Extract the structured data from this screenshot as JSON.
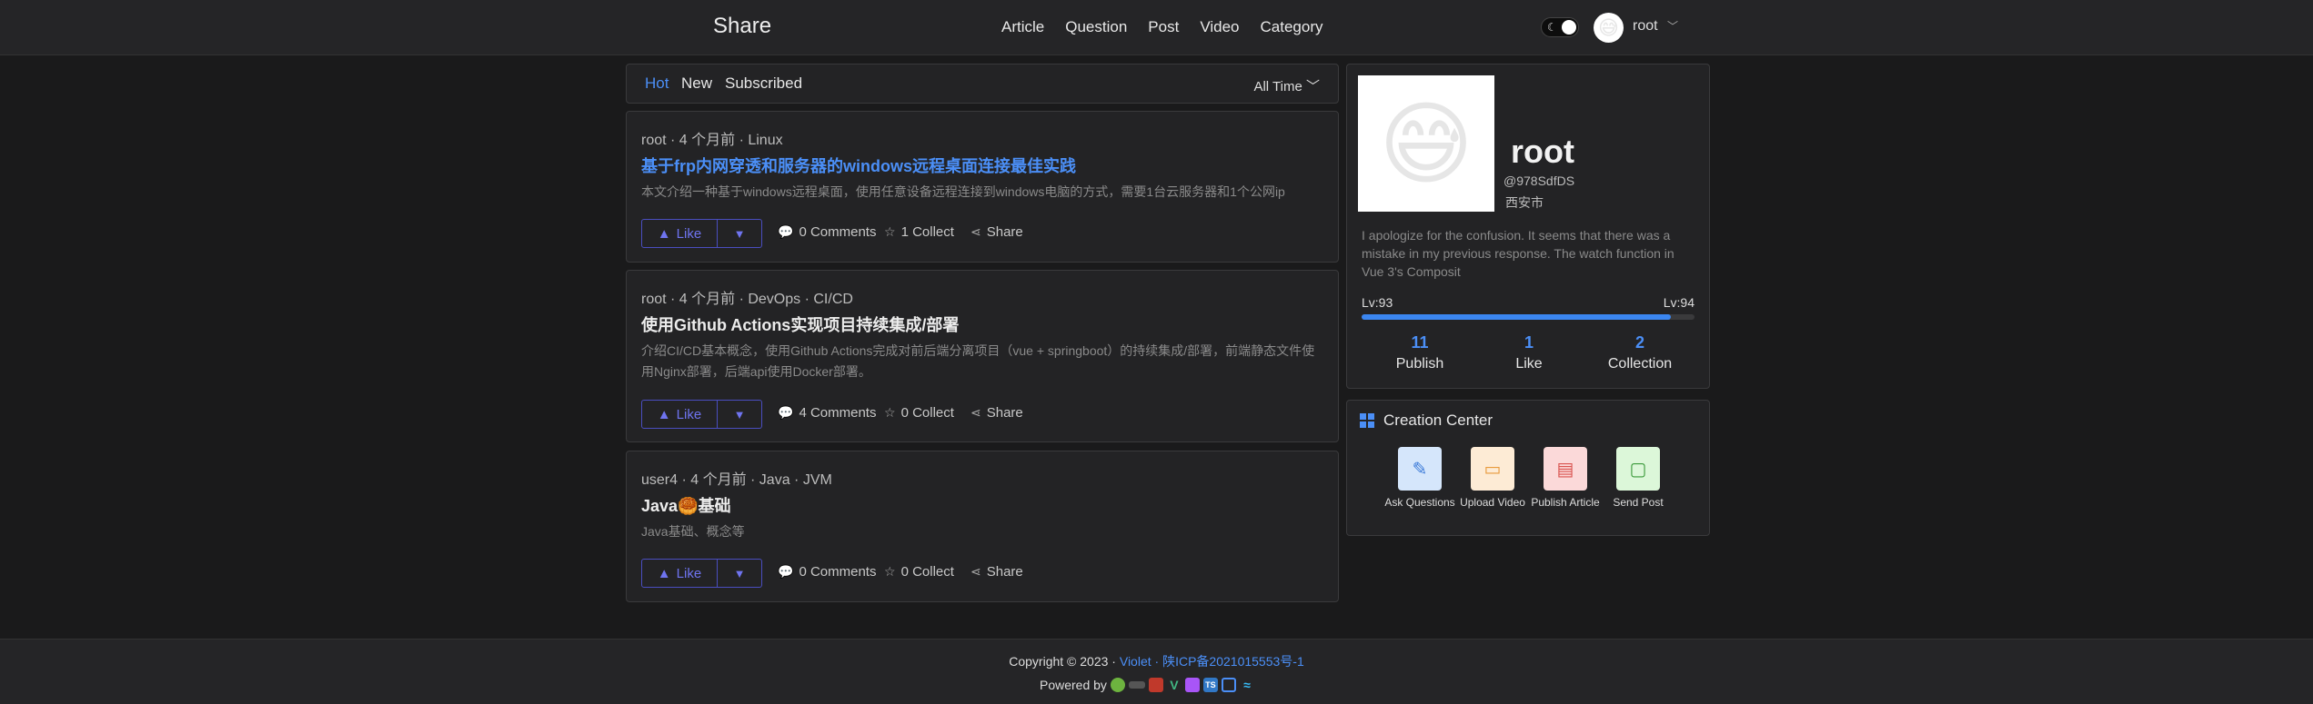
{
  "header": {
    "brand": "Share",
    "nav": [
      "Article",
      "Question",
      "Post",
      "Video",
      "Category"
    ],
    "theme_icon": "moon-icon",
    "user": {
      "name": "root",
      "avatar": "😅"
    }
  },
  "feed_tabs": {
    "tabs": [
      "Hot",
      "New",
      "Subscribed"
    ],
    "active": "Hot",
    "filter": "All Time"
  },
  "posts": [
    {
      "meta": "root · 4 个月前 · Linux",
      "title": "基于frp内网穿透和服务器的windows远程桌面连接最佳实践",
      "desc": "本文介绍一种基于windows远程桌面，使用任意设备远程连接到windows电脑的方式，需要1台云服务器和1个公网ip",
      "like": "Like",
      "comments": "0 Comments",
      "collect": "1 Collect",
      "share": "Share"
    },
    {
      "meta": "root · 4 个月前 · DevOps · CI/CD",
      "title": "使用Github Actions实现项目持续集成/部署",
      "desc": "介绍CI/CD基本概念，使用Github Actions完成对前后端分离项目（vue + springboot）的持续集成/部署，前端静态文件使用Nginx部署，后端api使用Docker部署。",
      "like": "Like",
      "comments": "4 Comments",
      "collect": "0 Collect",
      "share": "Share"
    },
    {
      "meta": "user4 · 4 个月前 · Java · JVM",
      "title": "Java🥮基础",
      "desc": "Java基础、概念等",
      "like": "Like",
      "comments": "0 Comments",
      "collect": "0 Collect",
      "share": "Share"
    }
  ],
  "profile": {
    "avatar": "😅",
    "name": "root",
    "handle": "@978SdfDS",
    "city": "西安市",
    "bio": "I apologize for the confusion. It seems that there was a mistake in my previous response. The watch function in Vue 3's Composit",
    "level_current": "Lv:93",
    "level_next": "Lv:94",
    "level_progress": 0.93,
    "stats": [
      {
        "value": "11",
        "label": "Publish"
      },
      {
        "value": "1",
        "label": "Like"
      },
      {
        "value": "2",
        "label": "Collection"
      }
    ]
  },
  "creation": {
    "title": "Creation Center",
    "items": [
      {
        "label": "Ask Questions",
        "icon": "pen-icon",
        "color": "#d5e6fb"
      },
      {
        "label": "Upload Video",
        "icon": "video-icon",
        "color": "#fdebd5"
      },
      {
        "label": "Publish Article",
        "icon": "document-icon",
        "color": "#fbd9d9"
      },
      {
        "label": "Send Post",
        "icon": "message-icon",
        "color": "#dcf7d9"
      }
    ]
  },
  "footer": {
    "copyright": "Copyright © 2023 · ",
    "site": "Violet",
    "sep": " · ",
    "icp": "陕ICP备2021015553号-1",
    "powered": "Powered by"
  },
  "colors": {
    "accent": "#4b8ff7",
    "like": "#6f74f0"
  }
}
